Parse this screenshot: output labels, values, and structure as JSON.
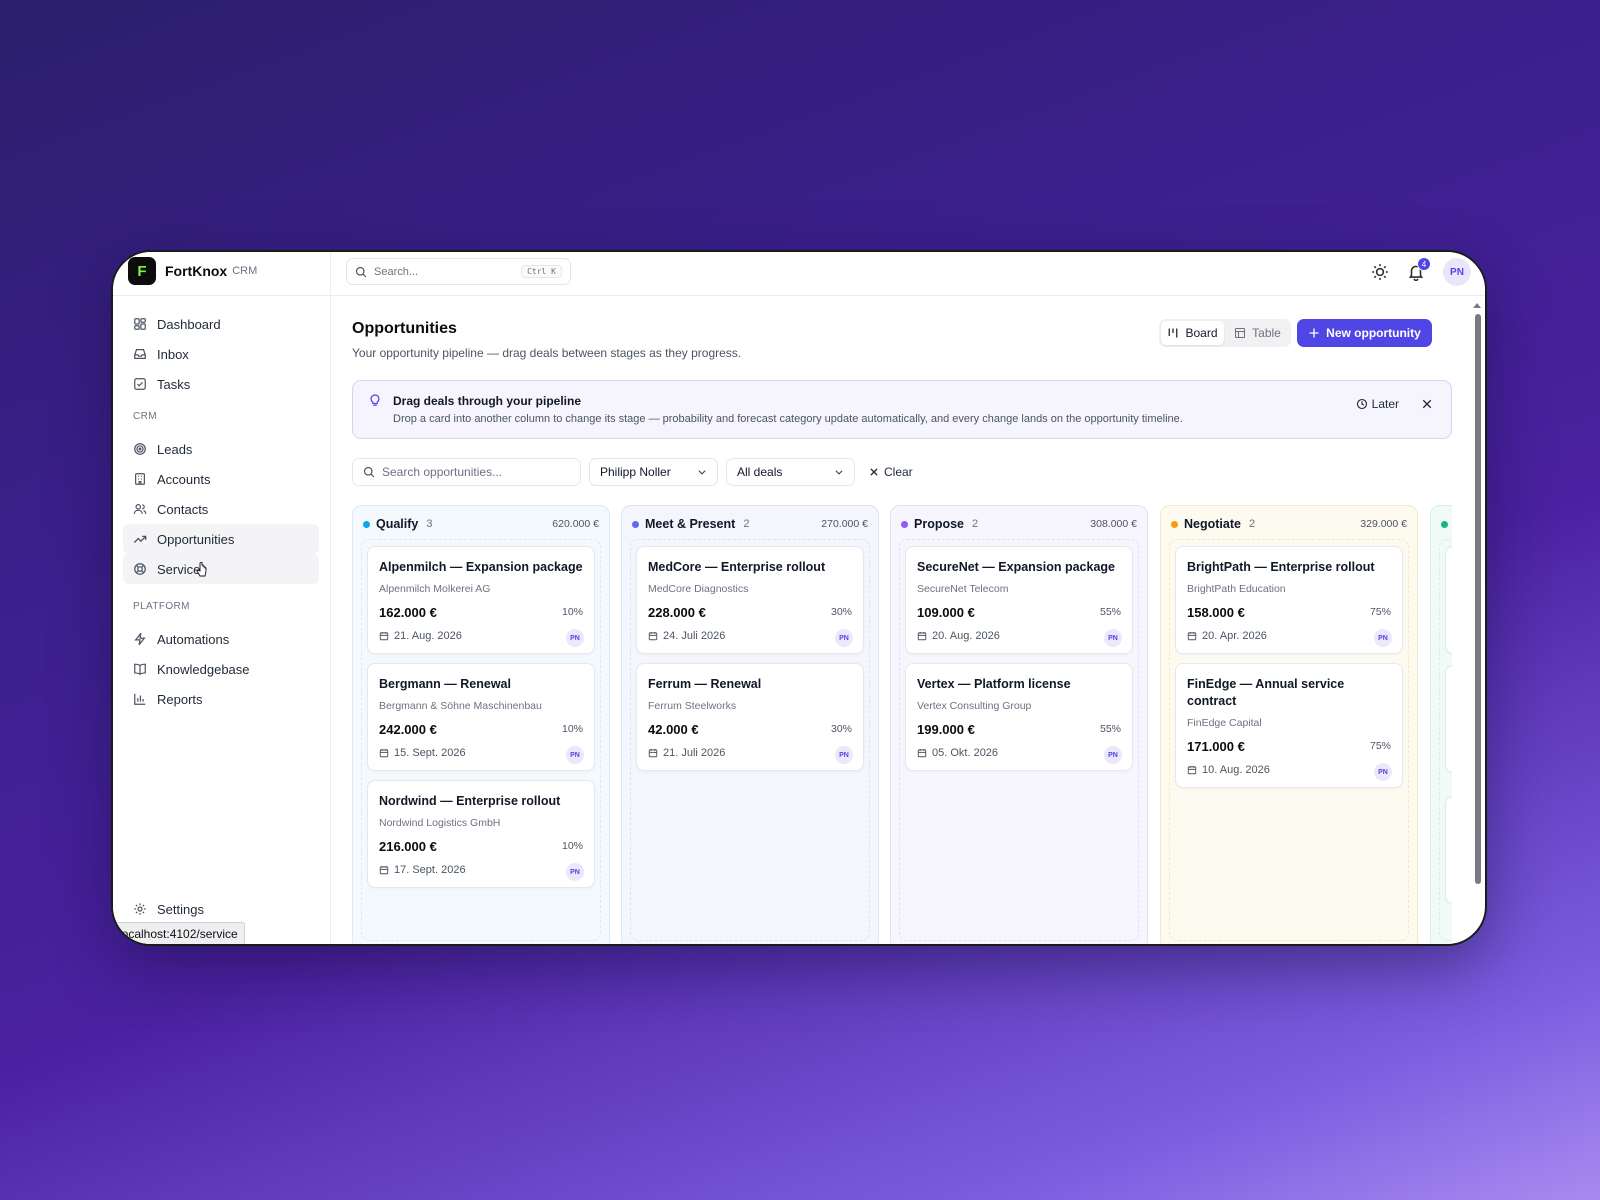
{
  "brand": {
    "name": "FortKnox",
    "sub": "CRM",
    "logo_letter": "F"
  },
  "sidebar": {
    "main_items": [
      {
        "label": "Dashboard",
        "icon": "dashboard-icon"
      },
      {
        "label": "Inbox",
        "icon": "inbox-icon"
      },
      {
        "label": "Tasks",
        "icon": "tasks-icon"
      }
    ],
    "crm_section": "CRM",
    "crm_items": [
      {
        "label": "Leads",
        "icon": "target-icon"
      },
      {
        "label": "Accounts",
        "icon": "building-icon"
      },
      {
        "label": "Contacts",
        "icon": "users-icon"
      },
      {
        "label": "Opportunities",
        "icon": "trending-up-icon"
      },
      {
        "label": "Service",
        "icon": "lifebuoy-icon"
      }
    ],
    "platform_section": "PLATFORM",
    "platform_items": [
      {
        "label": "Automations",
        "icon": "bolt-icon"
      },
      {
        "label": "Knowledgebase",
        "icon": "book-icon"
      },
      {
        "label": "Reports",
        "icon": "bar-chart-icon"
      }
    ],
    "settings_label": "Settings",
    "status_url": "localhost:4102/service"
  },
  "topbar": {
    "search_placeholder": "Search...",
    "search_shortcut": "Ctrl K",
    "notification_count": "4",
    "user_initials": "PN"
  },
  "page": {
    "title": "Opportunities",
    "subtitle": "Your opportunity pipeline — drag deals between stages as they progress.",
    "view_board": "Board",
    "view_table": "Table",
    "new_button": "New opportunity"
  },
  "banner": {
    "title": "Drag deals through your pipeline",
    "text": "Drop a card into another column to change its stage — probability and forecast category update automatically, and every change lands on the opportunity timeline.",
    "later": "Later"
  },
  "filters": {
    "search_placeholder": "Search opportunities...",
    "owner": "Philipp Noller",
    "deals": "All deals",
    "clear": "Clear"
  },
  "columns": [
    {
      "title": "Qualify",
      "count": "3",
      "total": "620.000 €",
      "color": "#0ea5e9",
      "bg": "#f3f9fd",
      "border": "#dbeaf5",
      "cards": [
        {
          "title": "Alpenmilch — Expansion package",
          "company": "Alpenmilch Molkerei AG",
          "amount": "162.000 €",
          "prob": "10%",
          "date": "21. Aug. 2026",
          "owner": "PN"
        },
        {
          "title": "Bergmann — Renewal",
          "company": "Bergmann & Söhne Maschinenbau",
          "amount": "242.000 €",
          "prob": "10%",
          "date": "15. Sept. 2026",
          "owner": "PN"
        },
        {
          "title": "Nordwind — Enterprise rollout",
          "company": "Nordwind Logistics GmbH",
          "amount": "216.000 €",
          "prob": "10%",
          "date": "17. Sept. 2026",
          "owner": "PN"
        }
      ]
    },
    {
      "title": "Meet & Present",
      "count": "2",
      "total": "270.000 €",
      "color": "#6366f1",
      "bg": "#f4f5fd",
      "border": "#dfe1f5",
      "cards": [
        {
          "title": "MedCore — Enterprise rollout",
          "company": "MedCore Diagnostics",
          "amount": "228.000 €",
          "prob": "30%",
          "date": "24. Juli 2026",
          "owner": "PN"
        },
        {
          "title": "Ferrum — Renewal",
          "company": "Ferrum Steelworks",
          "amount": "42.000 €",
          "prob": "30%",
          "date": "21. Juli 2026",
          "owner": "PN"
        }
      ]
    },
    {
      "title": "Propose",
      "count": "2",
      "total": "308.000 €",
      "color": "#8b5cf6",
      "bg": "#f7f5fd",
      "border": "#e5e0f6",
      "cards": [
        {
          "title": "SecureNet — Expansion package",
          "company": "SecureNet Telecom",
          "amount": "109.000 €",
          "prob": "55%",
          "date": "20. Aug. 2026",
          "owner": "PN"
        },
        {
          "title": "Vertex — Platform license",
          "company": "Vertex Consulting Group",
          "amount": "199.000 €",
          "prob": "55%",
          "date": "05. Okt. 2026",
          "owner": "PN"
        }
      ]
    },
    {
      "title": "Negotiate",
      "count": "2",
      "total": "329.000 €",
      "color": "#f59e0b",
      "bg": "#fdfaf0",
      "border": "#f3e9cc",
      "cards": [
        {
          "title": "BrightPath — Enterprise rollout",
          "company": "BrightPath Education",
          "amount": "158.000 €",
          "prob": "75%",
          "date": "20. Apr. 2026",
          "owner": "PN"
        },
        {
          "title": "FinEdge — Annual service contract",
          "company": "FinEdge Capital",
          "amount": "171.000 €",
          "prob": "75%",
          "date": "10. Aug. 2026",
          "owner": "PN"
        }
      ]
    },
    {
      "title": "",
      "count": "",
      "total": "",
      "color": "#10b981",
      "bg": "#f1fbf6",
      "border": "#d6f0e2",
      "cards": []
    }
  ]
}
